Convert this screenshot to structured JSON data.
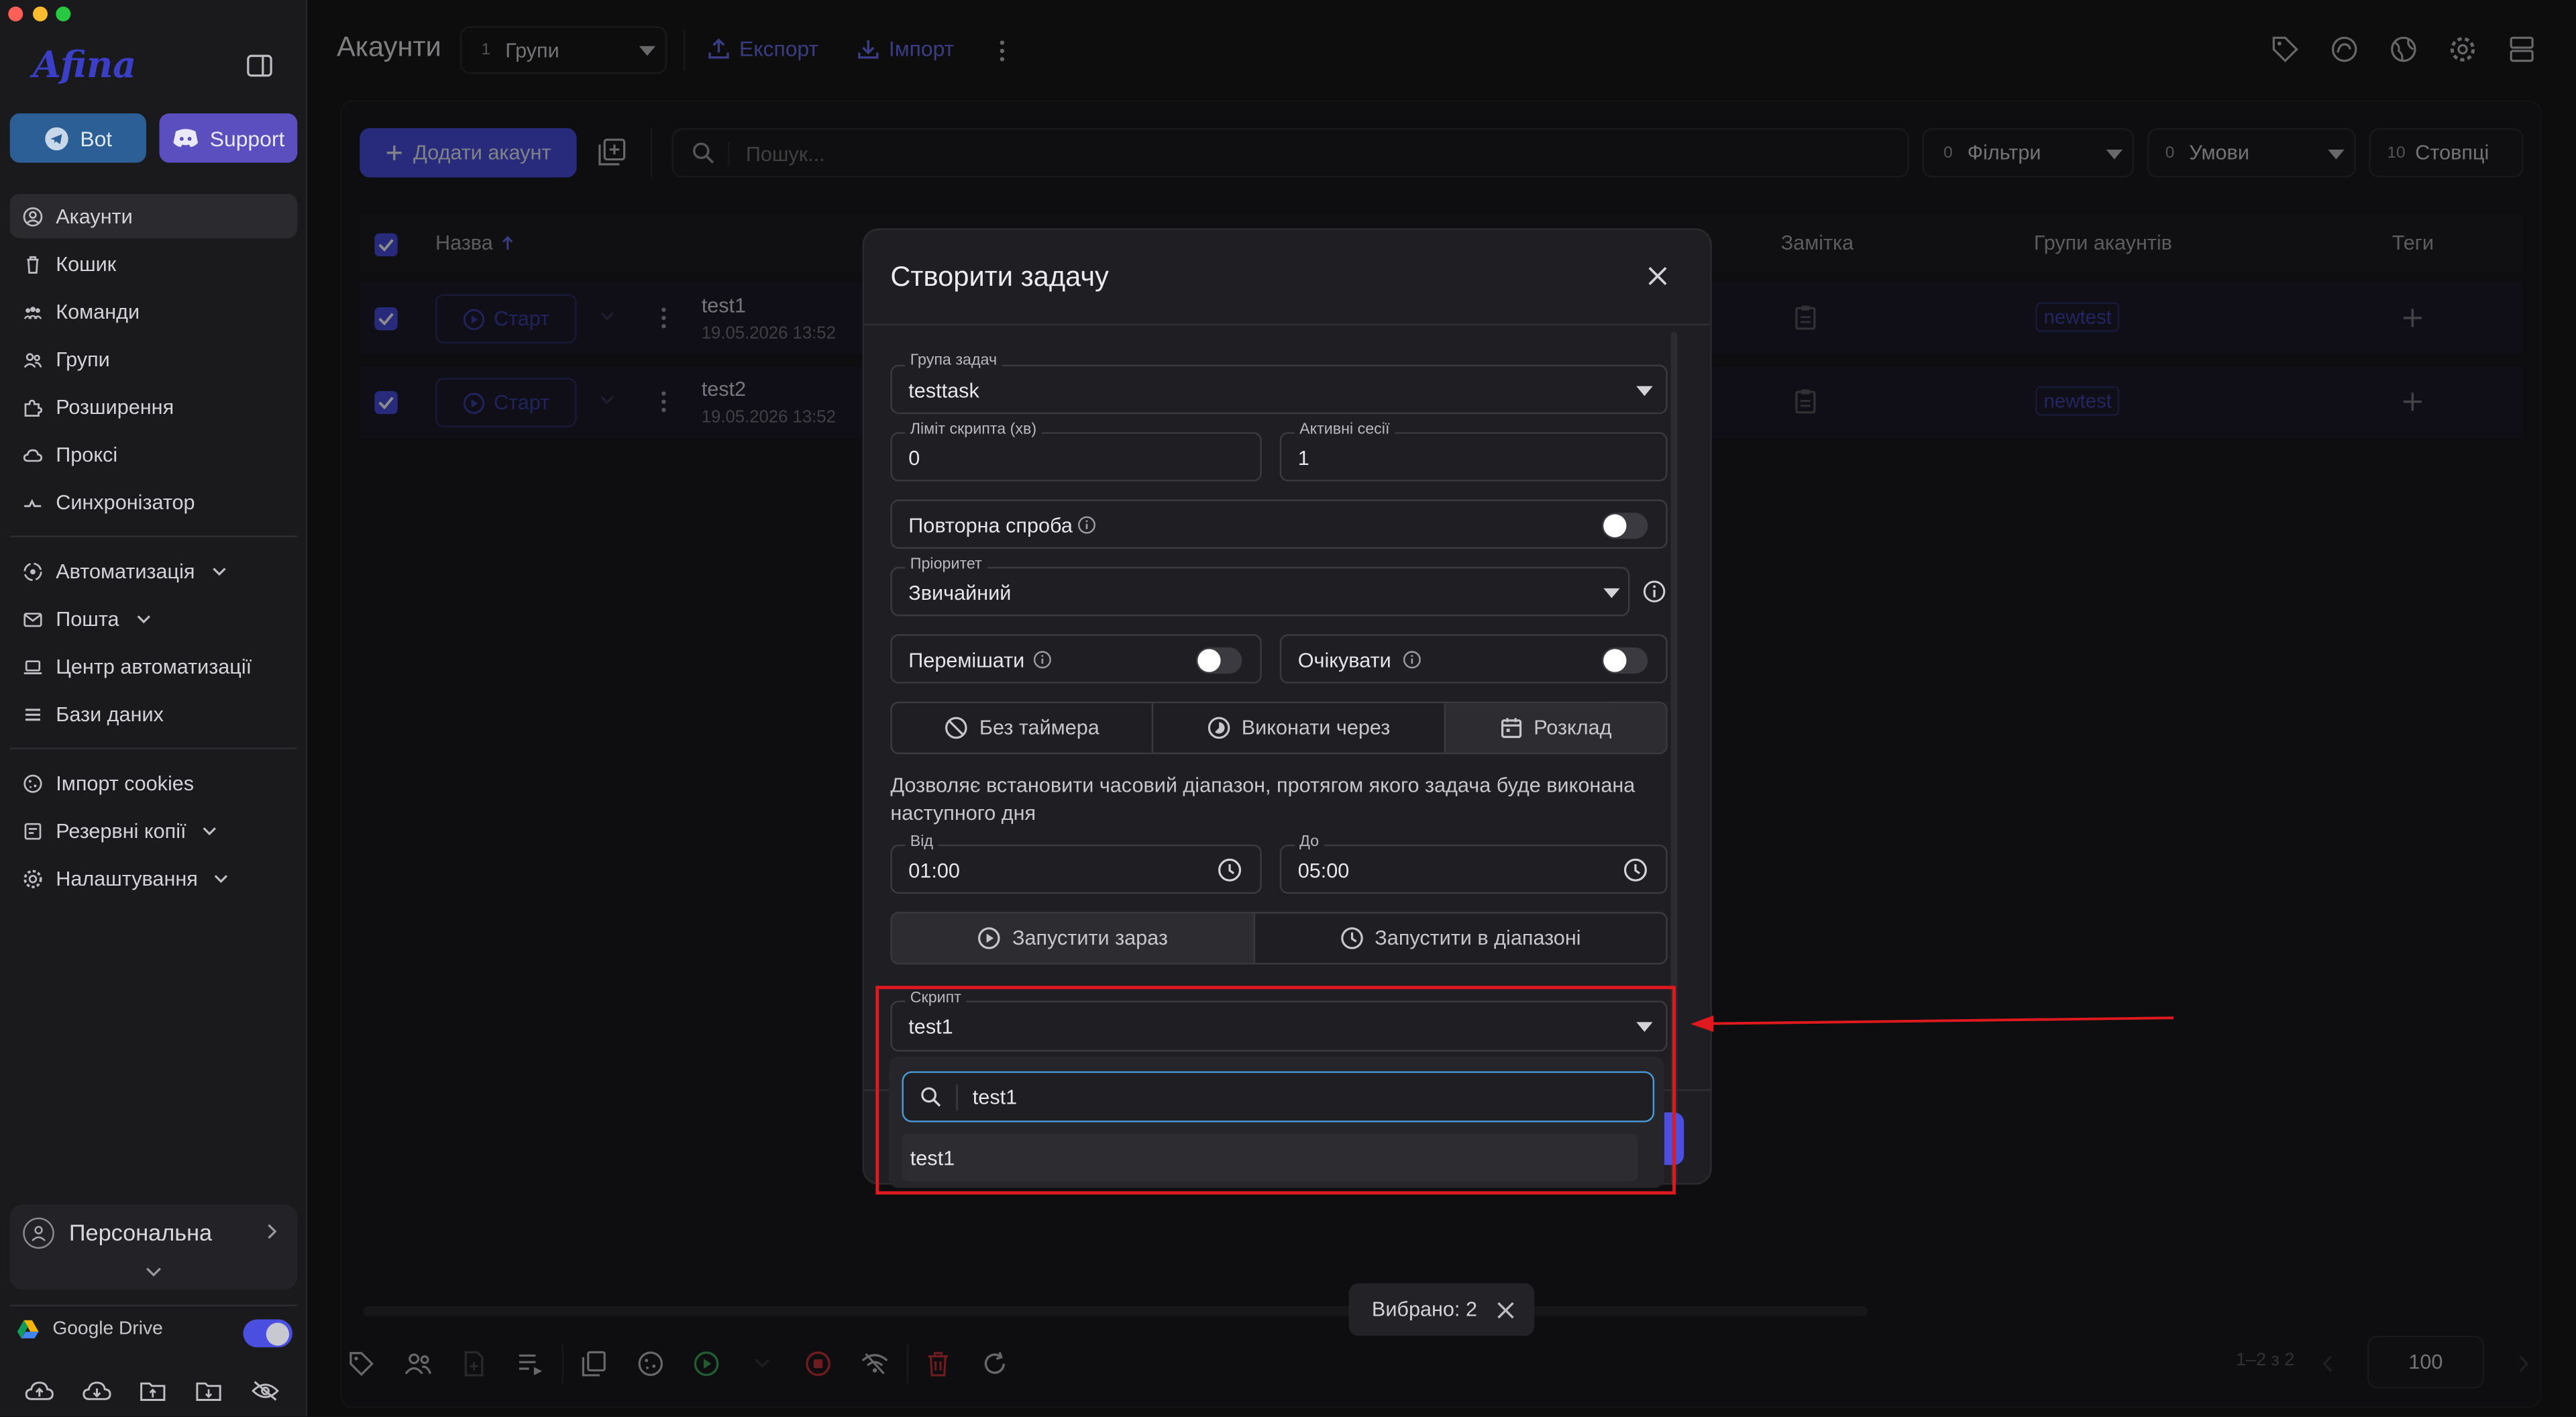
{
  "app": {
    "logo": "Afina",
    "colors": {
      "accent": "#4a4fe0",
      "link": "#6a6ff0",
      "annotation": "#e0191e",
      "bot": "#2c5f96",
      "support": "#5b4fbf"
    }
  },
  "sidebar": {
    "bot_label": "Bot",
    "support_label": "Support",
    "items": [
      {
        "label": "Акаунти",
        "icon": "user-circle-icon"
      },
      {
        "label": "Кошик",
        "icon": "trash-icon"
      },
      {
        "label": "Команди",
        "icon": "team-icon"
      },
      {
        "label": "Групи",
        "icon": "group-icon"
      },
      {
        "label": "Розширення",
        "icon": "puzzle-icon"
      },
      {
        "label": "Проксі",
        "icon": "cloud-icon"
      },
      {
        "label": "Синхронізатор",
        "icon": "sync-icon"
      }
    ],
    "items2": [
      {
        "label": "Автоматизація",
        "icon": "automation-icon"
      },
      {
        "label": "Пошта",
        "icon": "mail-icon"
      },
      {
        "label": "Центр автоматизації",
        "icon": "laptop-icon"
      },
      {
        "label": "Бази даних",
        "icon": "list-icon"
      }
    ],
    "items3": [
      {
        "label": "Імпорт cookies",
        "icon": "cookie-icon"
      },
      {
        "label": "Резервні копії",
        "icon": "backup-icon"
      },
      {
        "label": "Налаштування",
        "icon": "gear-icon"
      }
    ],
    "workspace": "Персональна",
    "drive_label": "Google Drive"
  },
  "header": {
    "title": "Акаунти",
    "groups_count": "1",
    "groups_label": "Групи",
    "export_label": "Експорт",
    "import_label": "Імпорт"
  },
  "toolbar": {
    "add_account": "Додати акаунт",
    "search_placeholder": "Пошук...",
    "filters_count": "0",
    "filters_label": "Фільтри",
    "conditions_count": "0",
    "conditions_label": "Умови",
    "columns_count": "10",
    "columns_label": "Стовпці"
  },
  "table": {
    "columns": {
      "name": "Назва",
      "note": "Замітка",
      "groups": "Групи акаунтів",
      "tags": "Теги"
    },
    "rows": [
      {
        "start": "Старт",
        "name": "test1",
        "date": "19.05.2026 13:52",
        "group_tag": "newtest"
      },
      {
        "start": "Старт",
        "name": "test2",
        "date": "19.05.2026 13:52",
        "group_tag": "newtest"
      }
    ]
  },
  "modal": {
    "title": "Створити задачу",
    "task_group_label": "Група задач",
    "task_group_value": "testtask",
    "script_limit_label": "Ліміт скрипта (хв)",
    "script_limit_value": "0",
    "active_sessions_label": "Активні сесії",
    "active_sessions_value": "1",
    "retry_label": "Повторна спроба",
    "retry_on": false,
    "priority_label": "Пріоритет",
    "priority_value": "Звичайний",
    "shuffle_label": "Перемішати",
    "shuffle_on": false,
    "wait_label": "Очікувати",
    "wait_on": false,
    "timer_tabs": [
      "Без таймера",
      "Виконати через",
      "Розклад"
    ],
    "timer_selected": "Розклад",
    "schedule_desc": "Дозволяє встановити часовий діапазон, протягом якого задача буде виконана наступного дня",
    "from_label": "Від",
    "from_value": "01:00",
    "to_label": "До",
    "to_value": "05:00",
    "run_tabs": [
      "Запустити зараз",
      "Запустити в діапазоні"
    ],
    "run_selected": "Запустити зараз",
    "script_label": "Скрипт",
    "script_value": "test1",
    "search_value": "test1",
    "dropdown_options": [
      "test1"
    ]
  },
  "bottom": {
    "selected_label": "Вибрано: 2",
    "pagination": "1–2 з 2",
    "per_page": "100"
  }
}
